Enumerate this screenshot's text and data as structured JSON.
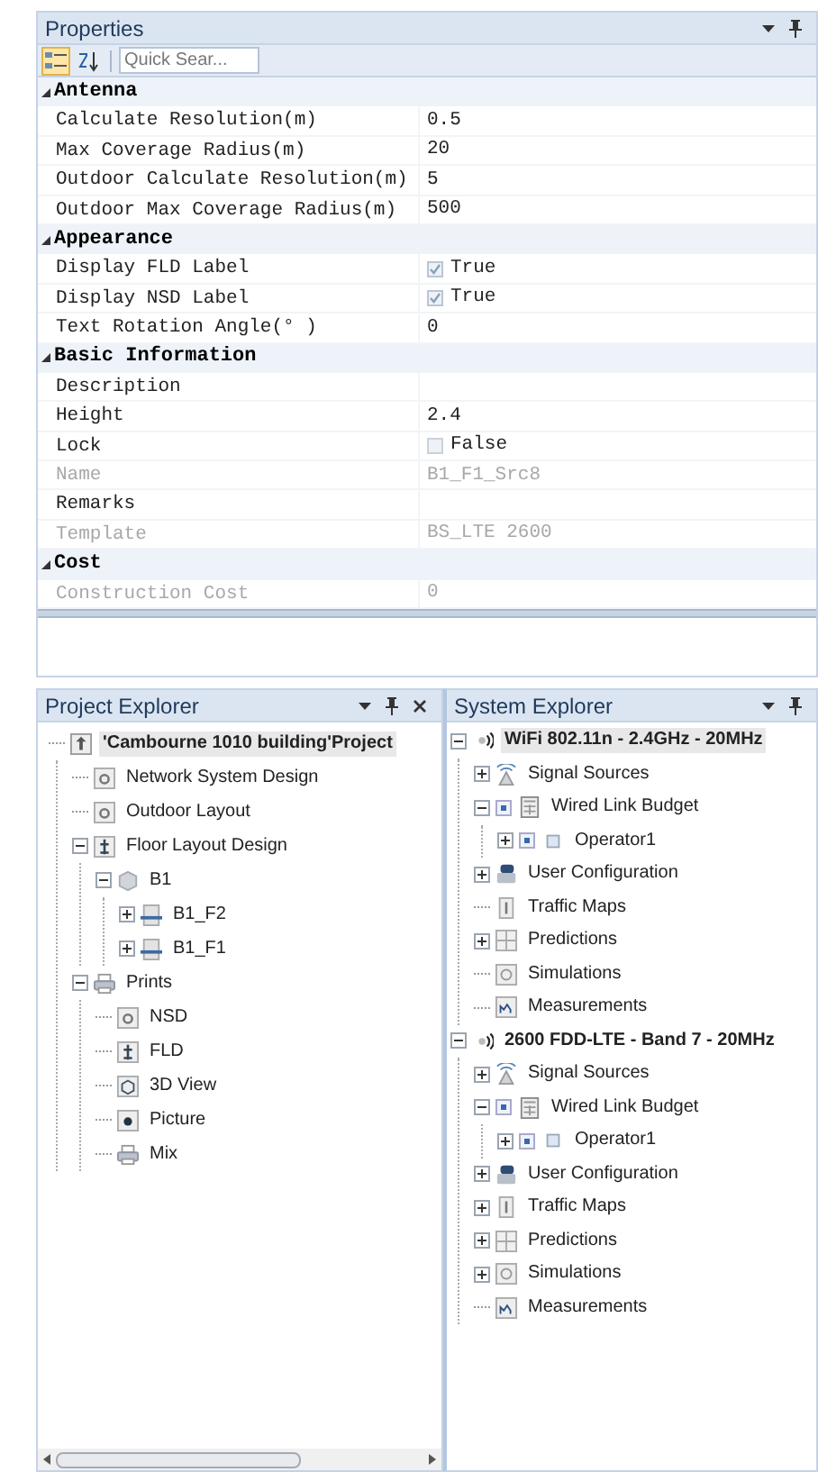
{
  "properties": {
    "title": "Properties",
    "toolbar": [
      {
        "kind": "categorized",
        "selected": true
      },
      {
        "kind": "alphabetical",
        "selected": false
      }
    ],
    "search": {
      "placeholder": "Quick Sear..."
    },
    "categories": [
      {
        "name": "Antenna",
        "expanded": true,
        "rows": [
          {
            "label": "Calculate Resolution(m)",
            "value": "0.5",
            "kind": "text",
            "disabled": false
          },
          {
            "label": "Max Coverage Radius(m)",
            "value": "20",
            "kind": "text",
            "disabled": false
          },
          {
            "label": "Outdoor Calculate Resolution(m)",
            "value": "5",
            "kind": "text",
            "disabled": false
          },
          {
            "label": "Outdoor Max Coverage Radius(m)",
            "value": "500",
            "kind": "text",
            "disabled": false
          }
        ]
      },
      {
        "name": "Appearance",
        "expanded": true,
        "rows": [
          {
            "label": "Display FLD Label",
            "value": "True",
            "kind": "checkbox",
            "checked": true,
            "disabled": false
          },
          {
            "label": "Display NSD Label",
            "value": "True",
            "kind": "checkbox",
            "checked": true,
            "disabled": false
          },
          {
            "label": "Text Rotation Angle(° )",
            "value": "0",
            "kind": "text",
            "disabled": false
          }
        ]
      },
      {
        "name": "Basic Information",
        "expanded": true,
        "rows": [
          {
            "label": "Description",
            "kind": "text",
            "disabled": false
          },
          {
            "label": "Height",
            "value": "2.4",
            "kind": "text",
            "disabled": false
          },
          {
            "label": "Lock",
            "value": "False",
            "kind": "checkbox",
            "checked": false,
            "disabled": false
          },
          {
            "label": "Name",
            "value": "B1_F1_Src8",
            "kind": "text",
            "disabled": true
          },
          {
            "label": "Remarks",
            "kind": "text",
            "disabled": false
          },
          {
            "label": "Template",
            "value": "BS_LTE 2600",
            "kind": "text",
            "disabled": true
          }
        ]
      },
      {
        "name": "Cost",
        "expanded": true,
        "rows": [
          {
            "label": "Construction Cost",
            "value": "0",
            "kind": "text",
            "disabled": true
          }
        ]
      }
    ]
  },
  "project_explorer": {
    "title": "Project Explorer",
    "tree": [
      {
        "label": "'Cambourne 1010 building'Project",
        "kind": "project",
        "selected": true,
        "children": [
          {
            "label": "Network System Design",
            "kind": "design",
            "selected": false
          },
          {
            "label": "Outdoor Layout",
            "kind": "design",
            "selected": false
          },
          {
            "label": "Floor Layout Design",
            "kind": "floor-design",
            "expanded": true,
            "selected": false,
            "children": [
              {
                "label": "B1",
                "kind": "building",
                "expanded": true,
                "selected": false,
                "children": [
                  {
                    "label": "B1_F2",
                    "kind": "floor",
                    "expanded": false,
                    "selected": false
                  },
                  {
                    "label": "B1_F1",
                    "kind": "floor",
                    "expanded": false,
                    "selected": false
                  }
                ]
              }
            ]
          },
          {
            "label": "Prints",
            "kind": "printer",
            "expanded": true,
            "selected": false,
            "children": [
              {
                "label": "NSD",
                "kind": "design",
                "selected": false
              },
              {
                "label": "FLD",
                "kind": "floor-design",
                "selected": false
              },
              {
                "label": "3D View",
                "kind": "view-3d",
                "selected": false
              },
              {
                "label": "Picture",
                "kind": "picture",
                "selected": false
              },
              {
                "label": "Mix",
                "kind": "printer",
                "selected": false
              }
            ]
          }
        ]
      }
    ]
  },
  "system_explorer": {
    "title": "System Explorer",
    "tree": [
      {
        "label": "WiFi 802.11n - 2.4GHz - 20MHz",
        "kind": "network",
        "expanded": true,
        "selected": true,
        "children": [
          {
            "label": "Signal Sources",
            "kind": "antenna",
            "expanded": false,
            "selected": false
          },
          {
            "label": "Wired Link Budget",
            "kind": "budget",
            "checked": true,
            "expanded": true,
            "selected": false,
            "children": [
              {
                "label": "Operator1",
                "kind": "operator",
                "checked": true,
                "expanded": false,
                "selected": false
              }
            ]
          },
          {
            "label": "User Configuration",
            "kind": "users",
            "expanded": false,
            "selected": false
          },
          {
            "label": "Traffic Maps",
            "kind": "traffic",
            "selected": false
          },
          {
            "label": "Predictions",
            "kind": "prediction",
            "expanded": false,
            "selected": false
          },
          {
            "label": "Simulations",
            "kind": "simulation",
            "selected": false
          },
          {
            "label": "Measurements",
            "kind": "measurement",
            "selected": false
          }
        ]
      },
      {
        "label": "2600 FDD-LTE - Band 7 - 20MHz",
        "kind": "network",
        "expanded": true,
        "selected": false,
        "children": [
          {
            "label": "Signal Sources",
            "kind": "antenna",
            "expanded": false,
            "selected": false
          },
          {
            "label": "Wired Link Budget",
            "kind": "budget",
            "checked": true,
            "expanded": true,
            "selected": false,
            "children": [
              {
                "label": "Operator1",
                "kind": "operator",
                "checked": true,
                "expanded": false,
                "selected": false
              }
            ]
          },
          {
            "label": "User Configuration",
            "kind": "users",
            "expanded": false,
            "selected": false
          },
          {
            "label": "Traffic Maps",
            "kind": "traffic",
            "expanded": false,
            "selected": false
          },
          {
            "label": "Predictions",
            "kind": "prediction",
            "expanded": false,
            "selected": false
          },
          {
            "label": "Simulations",
            "kind": "simulation",
            "expanded": false,
            "selected": false
          },
          {
            "label": "Measurements",
            "kind": "measurement",
            "selected": false
          }
        ]
      }
    ]
  }
}
